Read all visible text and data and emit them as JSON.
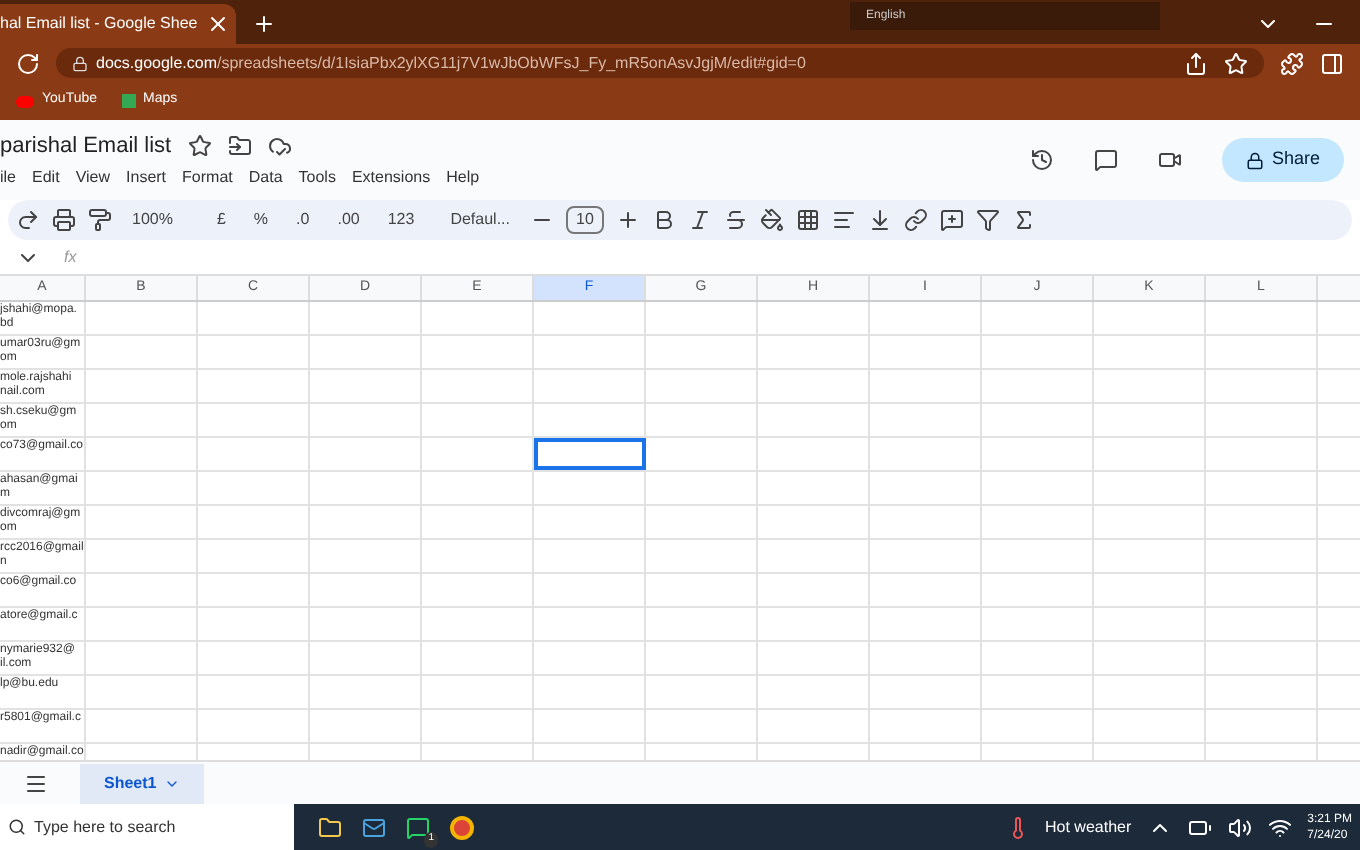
{
  "browser": {
    "tab_title": "hal Email list - Google Shee",
    "url_host": "docs.google.com",
    "url_path": "/spreadsheets/d/1IsiaPbx2ylXG11j7V1wJbObWFsJ_Fy_mR5onAsvJgjM/edit#gid=0",
    "bookmarks": [
      "YouTube",
      "Maps"
    ],
    "language": "English"
  },
  "doc": {
    "title": "parishal Email list",
    "share": "Share",
    "menu": [
      "ile",
      "Edit",
      "View",
      "Insert",
      "Format",
      "Data",
      "Tools",
      "Extensions",
      "Help"
    ]
  },
  "toolbar": {
    "zoom": "100%",
    "currency": "£",
    "percent": "%",
    "dec_decrease": ".0",
    "dec_increase": ".00",
    "number_format": "123",
    "font": "Defaul...",
    "font_size": "10"
  },
  "formula_bar": {
    "fx": "fx"
  },
  "columns": [
    {
      "label": "A",
      "selected": false
    },
    {
      "label": "B",
      "selected": false
    },
    {
      "label": "C",
      "selected": false
    },
    {
      "label": "D",
      "selected": false
    },
    {
      "label": "E",
      "selected": false
    },
    {
      "label": "F",
      "selected": true
    },
    {
      "label": "G",
      "selected": false
    },
    {
      "label": "H",
      "selected": false
    },
    {
      "label": "I",
      "selected": false
    },
    {
      "label": "J",
      "selected": false
    },
    {
      "label": "K",
      "selected": false
    },
    {
      "label": "L",
      "selected": false
    }
  ],
  "rows": [
    {
      "lines": [
        "jshahi@mopa.",
        "bd"
      ],
      "selected": false
    },
    {
      "lines": [
        "umar03ru@gm",
        "om"
      ],
      "selected": false
    },
    {
      "lines": [
        "mole.rajshahi",
        "nail.com"
      ],
      "selected": false
    },
    {
      "lines": [
        "sh.cseku@gm",
        "om"
      ],
      "selected": false
    },
    {
      "lines": [
        "co73@gmail.co"
      ],
      "selected": true
    },
    {
      "lines": [
        "ahasan@gmai",
        "m"
      ],
      "selected": false
    },
    {
      "lines": [
        "divcomraj@gm",
        "om"
      ],
      "selected": false
    },
    {
      "lines": [
        "rcc2016@gmail",
        "n"
      ],
      "selected": false
    },
    {
      "lines": [
        "co6@gmail.co"
      ],
      "selected": false
    },
    {
      "lines": [
        "atore@gmail.c"
      ],
      "selected": false
    },
    {
      "lines": [
        "nymarie932@",
        "il.com"
      ],
      "selected": false
    },
    {
      "lines": [
        "lp@bu.edu"
      ],
      "selected": false
    },
    {
      "lines": [
        "r5801@gmail.c"
      ],
      "selected": false
    },
    {
      "lines": [
        "nadir@gmail.co"
      ],
      "selected": false
    }
  ],
  "sheets": [
    {
      "label": "Sheet1",
      "selected": true
    }
  ],
  "taskbar": {
    "search": "Type here to search",
    "weather": "Hot weather",
    "time": "3:21 PM",
    "date": "7/24/20",
    "whatsapp_badge": "1"
  }
}
